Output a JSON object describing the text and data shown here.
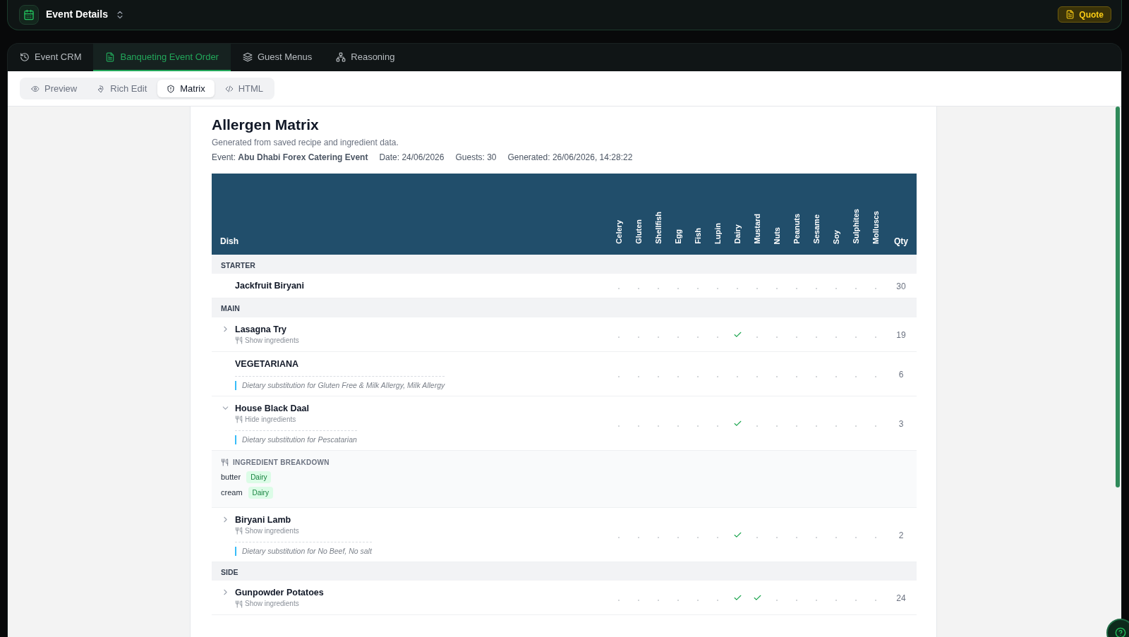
{
  "header": {
    "title": "Event Details",
    "quote_button": "Quote"
  },
  "tabs": [
    {
      "label": "Event CRM",
      "selected": false
    },
    {
      "label": "Banqueting Event Order",
      "selected": true
    },
    {
      "label": "Guest Menus",
      "selected": false
    },
    {
      "label": "Reasoning",
      "selected": false
    }
  ],
  "view_modes": [
    {
      "label": "Preview",
      "selected": false
    },
    {
      "label": "Rich Edit",
      "selected": false
    },
    {
      "label": "Matrix",
      "selected": true
    },
    {
      "label": "HTML",
      "selected": false
    }
  ],
  "document": {
    "title": "Allergen Matrix",
    "subtitle": "Generated from saved recipe and ingredient data.",
    "meta": [
      "Event: **Abu Dhabi Forex Catering Event**",
      "Date: 24/06/2026",
      "Guests: 30",
      "Generated: 26/06/2026, 14:28:22"
    ],
    "table": {
      "dish_column": "Dish",
      "allergen_columns": [
        "Celery",
        "Gluten",
        "Shellfish",
        "Egg",
        "Fish",
        "Lupin",
        "Dairy",
        "Mustard",
        "Nuts",
        "Peanuts",
        "Sesame",
        "Soy",
        "Sulphites",
        "Molluscs"
      ],
      "qty_column": "Qty",
      "rows": [
        {
          "kind": "section",
          "label": "STARTER"
        },
        {
          "kind": "dish",
          "name": "Jackfruit Biryani",
          "allergens": [
            false,
            false,
            false,
            false,
            false,
            false,
            false,
            false,
            false,
            false,
            false,
            false,
            false,
            false
          ],
          "qty": "30"
        },
        {
          "kind": "section",
          "label": "MAIN"
        },
        {
          "kind": "dish",
          "name": "Lasagna Try",
          "expanded": false,
          "ingredients_toggle": "Show ingredients",
          "allergens": [
            false,
            false,
            false,
            false,
            false,
            false,
            true,
            false,
            false,
            false,
            false,
            false,
            false,
            false
          ],
          "qty": "19"
        },
        {
          "kind": "dish",
          "name": "VEGETARIANA",
          "substitution": "Dietary substitution for Gluten Free & Milk Allergy, Milk Allergy",
          "allergens": [
            false,
            false,
            false,
            false,
            false,
            false,
            false,
            false,
            false,
            false,
            false,
            false,
            false,
            false
          ],
          "qty": "6"
        },
        {
          "kind": "dish",
          "name": "House Black Daal",
          "expanded": true,
          "ingredients_toggle": "Hide ingredients",
          "substitution": "Dietary substitution for Pescatarian",
          "allergens": [
            false,
            false,
            false,
            false,
            false,
            false,
            true,
            false,
            false,
            false,
            false,
            false,
            false,
            false
          ],
          "qty": "3"
        },
        {
          "kind": "breakdown",
          "title": "INGREDIENT BREAKDOWN",
          "items": [
            {
              "name": "butter",
              "tags": [
                "Dairy"
              ]
            },
            {
              "name": "cream",
              "tags": [
                "Dairy"
              ]
            }
          ]
        },
        {
          "kind": "dish",
          "name": "Biryani Lamb",
          "expanded": false,
          "ingredients_toggle": "Show ingredients",
          "substitution": "Dietary substitution for No Beef, No salt",
          "allergens": [
            false,
            false,
            false,
            false,
            false,
            false,
            true,
            false,
            false,
            false,
            false,
            false,
            false,
            false
          ],
          "qty": "2"
        },
        {
          "kind": "section",
          "label": "SIDE"
        },
        {
          "kind": "dish",
          "name": "Gunpowder Potatoes",
          "expanded": false,
          "ingredients_toggle": "Show ingredients",
          "allergens": [
            false,
            false,
            false,
            false,
            false,
            false,
            true,
            true,
            false,
            false,
            false,
            false,
            false,
            false
          ],
          "qty": "24"
        }
      ]
    }
  }
}
